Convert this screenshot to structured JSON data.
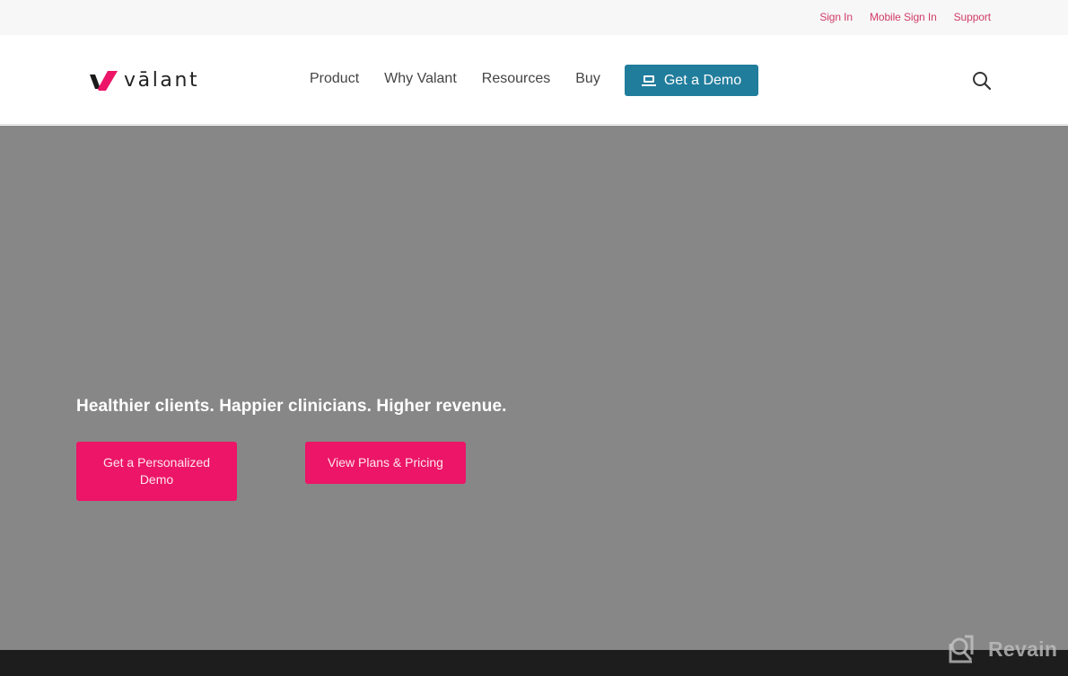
{
  "utility_nav": {
    "links": [
      "Sign In",
      "Mobile Sign In",
      "Support"
    ]
  },
  "header": {
    "logo_text": "vālant",
    "nav_items": [
      "Product",
      "Why Valant",
      "Resources",
      "Buy"
    ],
    "demo_button": "Get a Demo",
    "search_icon": "search-icon",
    "demo_icon": "laptop-icon"
  },
  "hero": {
    "headline": "Healthier clients. Happier clinicians. Higher revenue.",
    "cta_primary": "Get a Personalized Demo",
    "cta_secondary": "View Plans & Pricing"
  },
  "watermark": {
    "text": "Revain"
  },
  "colors": {
    "accent_pink": "#ec1567",
    "link_pink": "#d23c68",
    "demo_teal": "#217d9c",
    "hero_gray": "#878787",
    "footer_dark": "#1d1d1d"
  }
}
